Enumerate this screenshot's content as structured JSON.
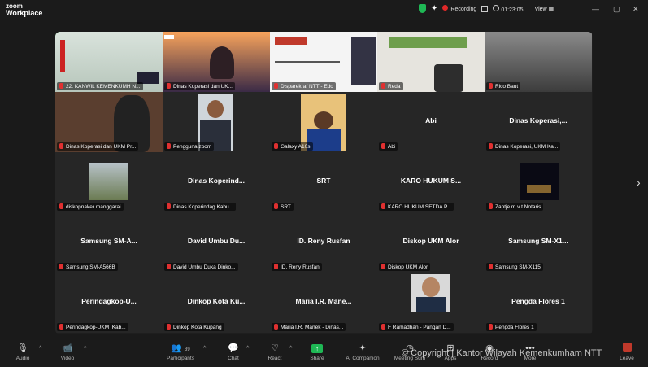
{
  "app": {
    "brand_line1": "zoom",
    "brand_line2": "Workplace"
  },
  "topbar": {
    "recording": "Recording",
    "timer": "01:23:05",
    "view": "View"
  },
  "tiles": [
    {
      "label": "22. KANWIL KEMENKUMH N...",
      "name": "",
      "video": "room",
      "active": true
    },
    {
      "label": "Dinas Koperasi dan UK...",
      "name": "",
      "video": "sunset"
    },
    {
      "label": "Disparekraf NTT - Edo",
      "name": "",
      "video": "slide"
    },
    {
      "label": "Reda",
      "name": "",
      "video": "office"
    },
    {
      "label": "Rico Baut",
      "name": "",
      "video": "blur"
    },
    {
      "label": "Dinas Koperasi  dan UKM Pr...",
      "name": "",
      "video": "man"
    },
    {
      "label": "Pengguna zoom",
      "name": "",
      "video": "small-portrait"
    },
    {
      "label": "Galaxy A10s",
      "name": "",
      "video": "small-portrait2"
    },
    {
      "label": "Abi",
      "name": "Abi",
      "video": "none"
    },
    {
      "label": "Dinas Koperasi, UKM Ka...",
      "name": "Dinas  Koperasi,...",
      "video": "none"
    },
    {
      "label": "diskopnaker manggarai",
      "name": "",
      "video": "village"
    },
    {
      "label": "Dinas Koperindag Kabu...",
      "name": "Dinas  Koperind...",
      "video": "none"
    },
    {
      "label": "SRT",
      "name": "SRT",
      "video": "none"
    },
    {
      "label": "KARO HUKUM SETDA P...",
      "name": "KARO HUKUM S...",
      "video": "none"
    },
    {
      "label": "Zantje m v t Notaris",
      "name": "",
      "video": "night"
    },
    {
      "label": "Samsung SM-A566B",
      "name": "Samsung  SM-A...",
      "video": "none"
    },
    {
      "label": "David Umbu Duka Dinko...",
      "name": "David Umbu Du...",
      "video": "none"
    },
    {
      "label": "ID. Reny Rusfan",
      "name": "ID. Reny Rusfan",
      "video": "none"
    },
    {
      "label": "Diskop UKM Alor",
      "name": "Diskop UKM Alor",
      "video": "none"
    },
    {
      "label": "Samsung SM-X115",
      "name": "Samsung  SM-X1...",
      "video": "none"
    },
    {
      "label": "Perindagkop-UKM_Kab...",
      "name": "Perindagkop-U...",
      "video": "none"
    },
    {
      "label": "Dinkop Kota Kupang",
      "name": "Dinkop Kota Ku...",
      "video": "none"
    },
    {
      "label": "Maria I.R. Manek - Dinas...",
      "name": "Maria I.R. Mane...",
      "video": "none"
    },
    {
      "label": "F Ramadhan - Pangan D...",
      "name": "",
      "video": "portrait"
    },
    {
      "label": "Pengda Flores 1",
      "name": "Pengda Flores 1",
      "video": "none"
    }
  ],
  "toolbar": {
    "audio": "Audio",
    "video": "Video",
    "participants": "Participants",
    "participants_count": "39",
    "chat": "Chat",
    "react": "React",
    "share": "Share",
    "ai": "AI Companion",
    "more1": "Meeting Sum",
    "apps": "Apps",
    "record": "Record",
    "more": "More",
    "leave": "Leave"
  },
  "watermark": "© Copyright | Kantor Wilayah Kemenkumham NTT",
  "colors": {
    "active_speaker": "#35d45a",
    "share": "#1fb855",
    "mic_off": "#e03030"
  }
}
